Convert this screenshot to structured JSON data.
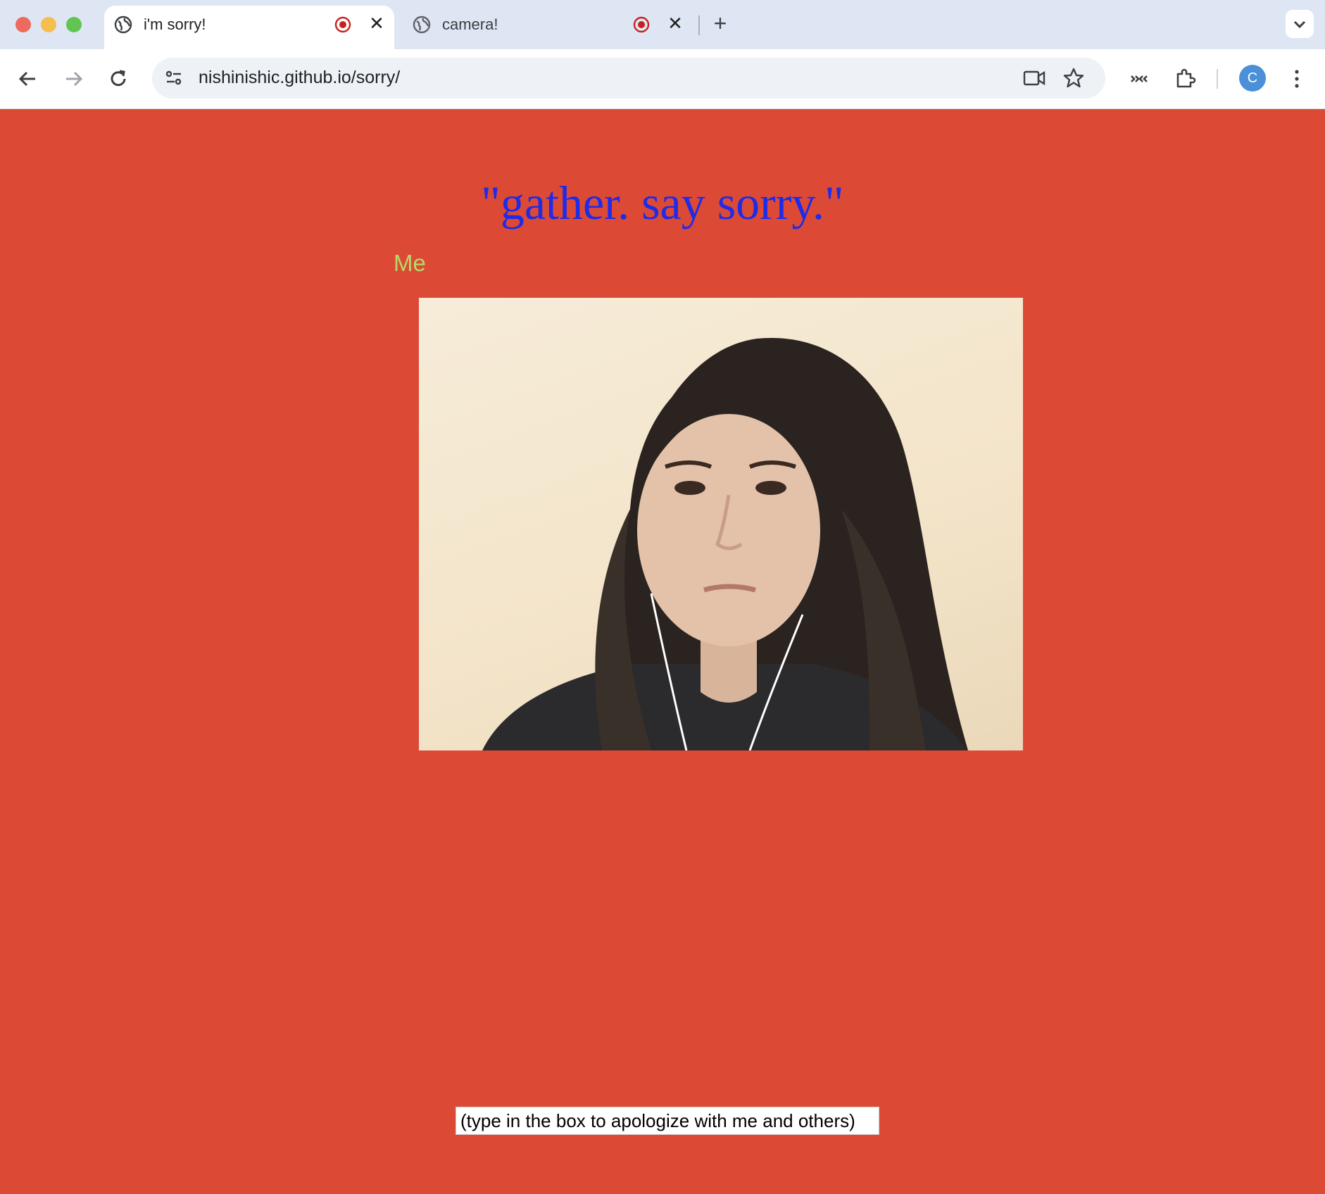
{
  "tabs": [
    {
      "title": "i'm sorry!",
      "active": true,
      "recording": true
    },
    {
      "title": "camera!",
      "active": false,
      "recording": true
    }
  ],
  "toolbar": {
    "url": "nishinishic.github.io/sorry/",
    "profile_initial": "C"
  },
  "page": {
    "headline": "\"gather. say sorry.\"",
    "me_label": "Me",
    "input_placeholder": "(type in the box to apologize with me and others)"
  },
  "colors": {
    "page_background": "#dc4a35",
    "headline": "#1f2be8",
    "me_label": "#b6d96a",
    "recording_indicator": "#c5221f",
    "profile_avatar": "#4a8fd8"
  },
  "icons": [
    "globe-icon",
    "record-icon",
    "close-icon",
    "plus-icon",
    "chevron-down-icon",
    "back-arrow-icon",
    "forward-arrow-icon",
    "reload-icon",
    "site-settings-icon",
    "camera-icon",
    "star-icon",
    "media-controls-icon",
    "extensions-icon",
    "kebab-menu-icon"
  ]
}
